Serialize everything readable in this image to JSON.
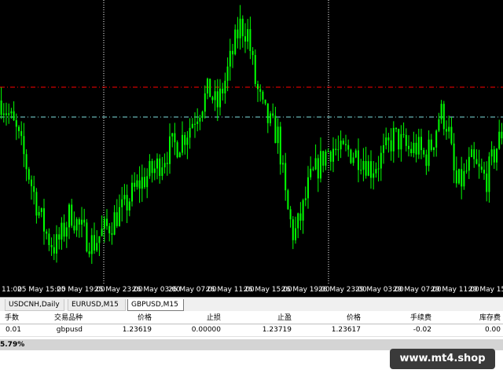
{
  "chart": {
    "symbol": "GBPUSD",
    "timeframe": "M15",
    "colors": {
      "background": "#000000",
      "candle": "#00ff00",
      "grid": "#ffffff",
      "stop_line": "#ff0000",
      "bid_line": "#7fdfdf"
    },
    "time_labels": [
      "11:00",
      "25 May 15:00",
      "25 May 19:00",
      "25 May 23:00",
      "26 May 03:00",
      "26 May 07:00",
      "26 May 11:00",
      "26 May 15:00",
      "26 May 19:00",
      "26 May 23:00",
      "29 May 03:00",
      "29 May 07:00",
      "29 May 11:00",
      "29 May 15:00"
    ],
    "close_series": [
      1.2375,
      1.2371,
      1.2366,
      1.2359,
      1.2351,
      1.2343,
      1.2337,
      1.2334,
      1.2338,
      1.2344,
      1.234,
      1.2337,
      1.2335,
      1.2338,
      1.234,
      1.2343,
      1.2345,
      1.2349,
      1.2352,
      1.2354,
      1.2356,
      1.2359,
      1.2362,
      1.2363,
      1.2366,
      1.237,
      1.2374,
      1.2378,
      1.2373,
      1.238,
      1.2388,
      1.2396,
      1.2394,
      1.238,
      1.2372,
      1.2368,
      1.2365,
      1.2346,
      1.2337,
      1.2343,
      1.2352,
      1.2356,
      1.236,
      1.2362,
      1.236,
      1.2361,
      1.236,
      1.2359,
      1.2356,
      1.2358,
      1.2361,
      1.2365,
      1.2363,
      1.2361,
      1.2362,
      1.2359,
      1.2363,
      1.2372,
      1.2368,
      1.2351,
      1.2353,
      1.2358,
      1.2355,
      1.2353,
      1.236,
      1.2366
    ]
  },
  "tabs": [
    {
      "label": "USDCNH,Daily"
    },
    {
      "label": "EURUSD,M15"
    },
    {
      "label": "GBPUSD,M15"
    }
  ],
  "terminal": {
    "columns": [
      "手数",
      "交易品种",
      "价格",
      "止损",
      "止盈",
      "价格",
      "手续费",
      "库存费"
    ],
    "row": {
      "lots": "0.01",
      "symbol": "gbpusd",
      "open_price": "1.23619",
      "stop_loss": "0.00000",
      "take_profit": "1.23719",
      "current_price": "1.23617",
      "commission": "-0.02",
      "swap": "0.00"
    },
    "balance_text": "5.79%"
  },
  "watermark": "www.mt4.shop"
}
